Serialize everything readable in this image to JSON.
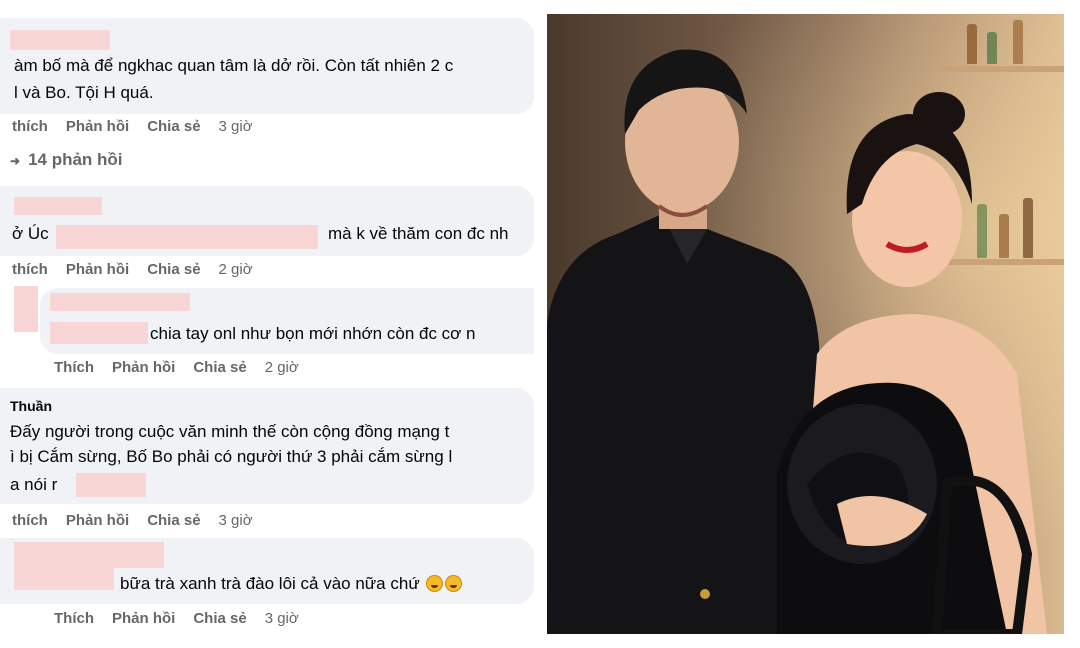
{
  "comments": [
    {
      "lines": [
        "àm bố mà để ngkhac quan tâm là dở rồi. Còn tất nhiên 2 c",
        "l và Bo. Tội H quá."
      ],
      "actions": {
        "like": "thích",
        "reply": "Phản hồi",
        "share": "Chia sẻ",
        "time": "3 giờ"
      },
      "replies_label": "14 phản hồi"
    },
    {
      "lines": [
        "ở Úc",
        "mà k về thăm con đc nh"
      ],
      "actions": {
        "like": "thích",
        "reply": "Phản hồi",
        "share": "Chia sẻ",
        "time": "2 giờ"
      }
    },
    {
      "lines": [
        "chia tay onl như bọn mới nhớn còn đc cơ n"
      ],
      "actions": {
        "like": "Thích",
        "reply": "Phản hồi",
        "share": "Chia sẻ",
        "time": "2 giờ"
      }
    },
    {
      "name": "Thuần",
      "lines": [
        "Đấy người trong cuộc văn minh thế còn cộng đồng mạng t",
        "ì bị Cắm sừng, Bố Bo phải có người thứ 3 phải cắm sừng l",
        "a nói r"
      ],
      "actions": {
        "like": "thích",
        "reply": "Phản hồi",
        "share": "Chia sẻ",
        "time": "3 giờ"
      }
    },
    {
      "lines": [
        "bữa trà xanh trà đào lôi cả vào nữa chứ"
      ],
      "emoji": "laughing-emoji",
      "actions": {
        "like": "Thích",
        "reply": "Phản hồi",
        "share": "Chia sẻ",
        "time": "3 giờ"
      }
    }
  ],
  "colors": {
    "bubble": "#f0f2f5",
    "redaction": "#f9d6d6",
    "meta_text": "#65676b",
    "body_text": "#050505"
  }
}
